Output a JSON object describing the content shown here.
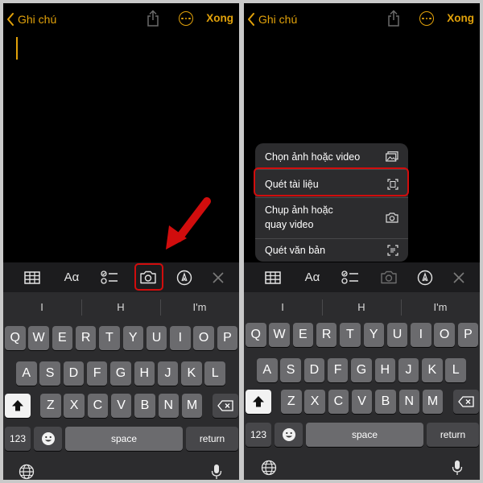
{
  "screens": {
    "left": {
      "nav": {
        "back_label": "Ghi chú",
        "done_label": "Xong"
      },
      "toolbar": {
        "format_label": "Aα"
      }
    },
    "right": {
      "nav": {
        "back_label": "Ghi chú",
        "done_label": "Xong"
      },
      "toolbar": {
        "format_label": "Aα"
      },
      "camera_menu": {
        "items": [
          {
            "label": "Chọn ảnh hoặc video",
            "icon": "photo-library-icon"
          },
          {
            "label": "Quét tài liệu",
            "icon": "document-scan-icon"
          },
          {
            "label": "Chụp ảnh hoặc\nquay video",
            "icon": "camera-icon"
          },
          {
            "label": "Quét văn bản",
            "icon": "text-scan-icon"
          }
        ],
        "highlighted_item": "Quét tài liệu"
      }
    }
  },
  "keyboard": {
    "suggestions": [
      "I",
      "H",
      "I'm"
    ],
    "rows": [
      [
        "Q",
        "W",
        "E",
        "R",
        "T",
        "Y",
        "U",
        "I",
        "O",
        "P"
      ],
      [
        "A",
        "S",
        "D",
        "F",
        "G",
        "H",
        "J",
        "K",
        "L"
      ],
      [
        "Z",
        "X",
        "C",
        "V",
        "B",
        "N",
        "M"
      ]
    ],
    "numbers_label": "123",
    "space_label": "space",
    "return_label": "return"
  },
  "colors": {
    "accent": "#e2a20a",
    "highlight": "#d10d0d",
    "background": "#000000",
    "keyboard_bg": "#2c2c2e",
    "key_bg": "#6b6b6e"
  }
}
